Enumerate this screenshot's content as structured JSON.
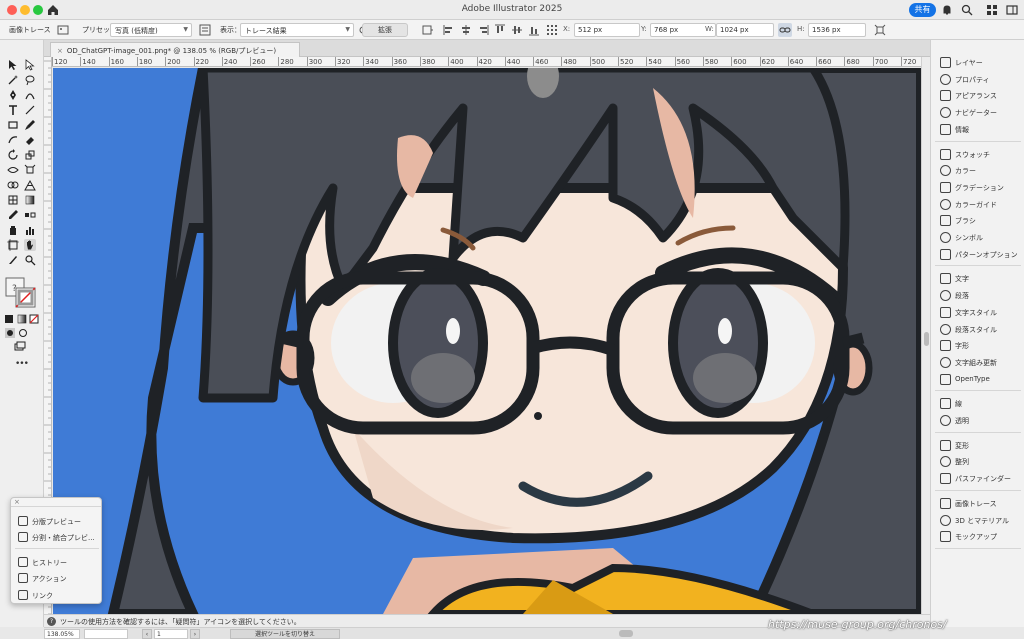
{
  "window": {
    "title": "Adobe Illustrator 2025",
    "share_label": "共有"
  },
  "controlbar": {
    "panel_name": "画像トレース",
    "preset_label": "プリセット：",
    "preset_value": "写真 (低精度)",
    "view_label": "表示：",
    "view_value": "トレース結果",
    "expand_button": "拡張",
    "x_label": "X:",
    "x_value": "512 px",
    "y_label": "Y:",
    "y_value": "768 px",
    "w_label": "W:",
    "w_value": "1024 px",
    "h_label": "H:",
    "h_value": "1536 px"
  },
  "document": {
    "tab_title": "OD_ChatGPT-image_001.png* @ 138.05 % (RGB/プレビュー)",
    "close_glyph": "×"
  },
  "ruler": {
    "horizontal": [
      "120",
      "140",
      "160",
      "180",
      "200",
      "220",
      "240",
      "260",
      "280",
      "300",
      "320",
      "340",
      "360",
      "380",
      "400",
      "420",
      "440",
      "460",
      "480",
      "500",
      "520",
      "540",
      "560",
      "580",
      "600",
      "620",
      "640",
      "660",
      "680",
      "700",
      "720"
    ]
  },
  "right_panel": {
    "groups": [
      [
        "レイヤー",
        "プロパティ",
        "アピアランス",
        "ナビゲーター",
        "情報"
      ],
      [
        "スウォッチ",
        "カラー",
        "グラデーション",
        "カラーガイド",
        "ブラシ",
        "シンボル",
        "パターンオプション"
      ],
      [
        "文字",
        "段落",
        "文字スタイル",
        "段落スタイル",
        "字形",
        "文字組み更新",
        "OpenType"
      ],
      [
        "線",
        "透明"
      ],
      [
        "変形",
        "整列",
        "パスファインダー"
      ],
      [
        "画像トレース",
        "3D とマテリアル",
        "モックアップ"
      ]
    ]
  },
  "float_panel": {
    "items": [
      "分版プレビュー",
      "分割・統合プレビ...",
      "ヒストリー",
      "アクション",
      "リンク"
    ]
  },
  "statusbar": {
    "hint": "ツールの使用方法を確認するには、「疑問符」アイコンを選択してください。",
    "help_glyph": "?",
    "zoom": "138.05%",
    "artboard": "1",
    "toggle_label": "選択ツールを切り替え",
    "nav_prev": "‹",
    "nav_next": "›"
  },
  "toolbar": {
    "more_glyph": "•••"
  },
  "watermark": "https://muse-group.org/chronos/",
  "colors": {
    "canvas_bg": "#3f7bd6",
    "hair": "#4a4e57",
    "outline": "#1f2226",
    "skin": "#f7e6da",
    "accent_blue": "#1473e6",
    "jacket": "#f2b21f"
  }
}
